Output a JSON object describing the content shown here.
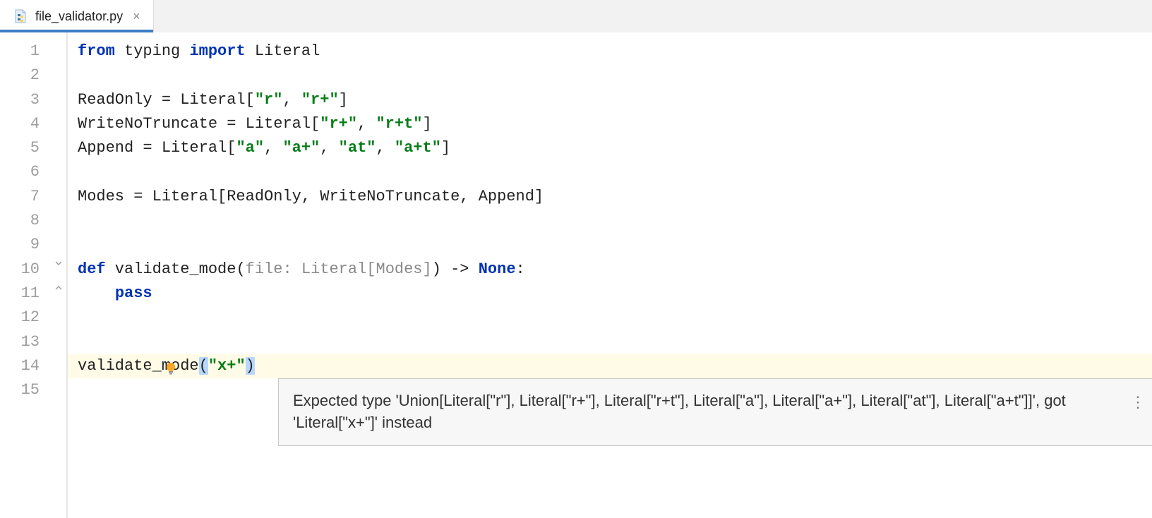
{
  "tab": {
    "filename": "file_validator.py",
    "close_icon": "×"
  },
  "gutter": {
    "lines": [
      "1",
      "2",
      "3",
      "4",
      "5",
      "6",
      "7",
      "8",
      "9",
      "10",
      "11",
      "12",
      "13",
      "14",
      "15"
    ]
  },
  "code": {
    "line1": {
      "from": "from",
      "typing": " typing ",
      "import": "import",
      "literal": " Literal"
    },
    "line3": {
      "pre": "ReadOnly = Literal[",
      "s1": "\"r\"",
      "c1": ", ",
      "s2": "\"r+\"",
      "post": "]"
    },
    "line4": {
      "pre": "WriteNoTruncate = Literal[",
      "s1": "\"r+\"",
      "c1": ", ",
      "s2": "\"r+t\"",
      "post": "]"
    },
    "line5": {
      "pre": "Append = Literal[",
      "s1": "\"a\"",
      "c1": ", ",
      "s2": "\"a+\"",
      "c2": ", ",
      "s3": "\"at\"",
      "c3": ", ",
      "s4": "\"a+t\"",
      "post": "]"
    },
    "line7": "Modes = Literal[ReadOnly, WriteNoTruncate, Append]",
    "line10": {
      "def": "def",
      "name": " validate_mode(",
      "param": "file: Literal[Modes]",
      "rest": ") -> ",
      "none": "None",
      "colon": ":"
    },
    "line11": {
      "indent": "    ",
      "pass": "pass"
    },
    "line14": {
      "call": "validate_mode",
      "lparen": "(",
      "arg": "\"x+\"",
      "rparen": ")"
    }
  },
  "tooltip": {
    "text": "Expected type 'Union[Literal[\"r\"], Literal[\"r+\"], Literal[\"r+t\"], Literal[\"a\"], Literal[\"a+\"], Literal[\"at\"], Literal[\"a+t\"]]', got 'Literal[\"x+\"]' instead",
    "menu": "⋮"
  }
}
